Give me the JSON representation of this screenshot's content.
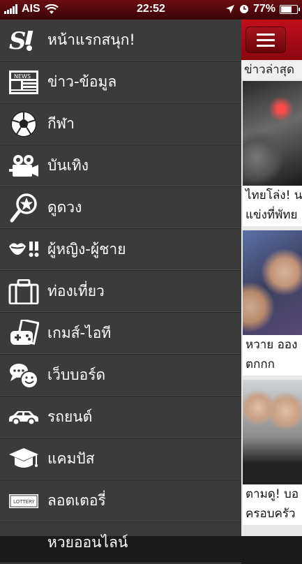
{
  "status_bar": {
    "carrier": "AIS",
    "time": "22:52",
    "battery_percent": "77%",
    "battery_level": 0.77
  },
  "menu": {
    "items": [
      {
        "label": "หน้าแรกสนุก!",
        "icon": "sanook-logo-icon"
      },
      {
        "label": "ข่าว-ข้อมูล",
        "icon": "news-icon"
      },
      {
        "label": "กีฬา",
        "icon": "soccer-ball-icon"
      },
      {
        "label": "บันเทิง",
        "icon": "movie-camera-icon"
      },
      {
        "label": "ดูดวง",
        "icon": "magnifier-star-icon"
      },
      {
        "label": "ผู้หญิง-ผู้ชาย",
        "icon": "lips-mustache-icon"
      },
      {
        "label": "ท่องเที่ยว",
        "icon": "suitcase-icon"
      },
      {
        "label": "เกมส์-ไอที",
        "icon": "game-controller-icon"
      },
      {
        "label": "เว็บบอร์ด",
        "icon": "chat-bubbles-icon"
      },
      {
        "label": "รถยนต์",
        "icon": "car-icon"
      },
      {
        "label": "แคมปัส",
        "icon": "graduation-cap-icon"
      },
      {
        "label": "ลอตเตอรี่",
        "icon": "lottery-ticket-icon"
      },
      {
        "label": "หวยออนไลน์",
        "icon": "partial-icon"
      }
    ]
  },
  "content": {
    "section_label": "ข่าวล่าสุด",
    "news": [
      {
        "title_line1": "ไทยโล่ง! น",
        "title_line2": "แข่งที่พัทย"
      },
      {
        "title_line1": "หวาย ออง",
        "title_line2": "ตกกก"
      },
      {
        "title_line1": "ตามดู! บอ",
        "title_line2": "ครอบครัว"
      }
    ]
  },
  "colors": {
    "status_bar": "#5a0a0f",
    "menu_bg": "#3b3b3b",
    "topbar_red": "#b00e18"
  }
}
